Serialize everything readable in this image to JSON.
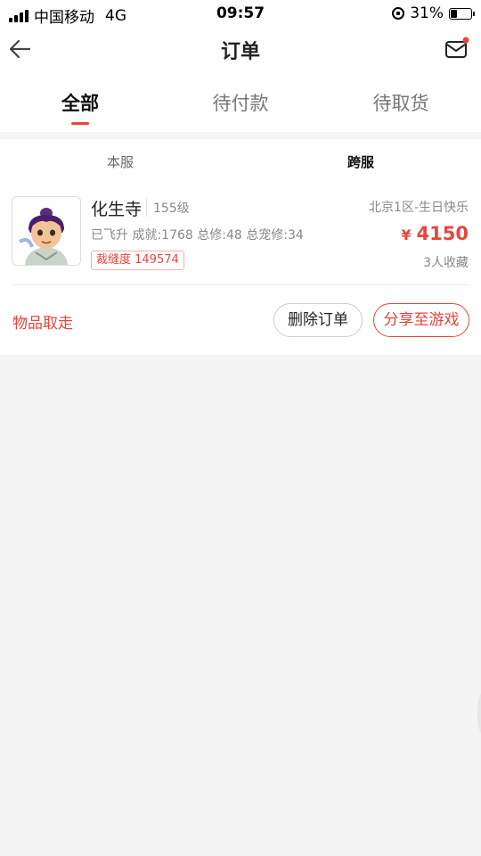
{
  "status_bar": {
    "carrier": "中国移动",
    "network": "4G",
    "time": "09:57",
    "battery_percent": "31%",
    "battery_level": 0.31
  },
  "nav": {
    "title": "订单",
    "back_icon": "arrow-left-icon",
    "mail_icon": "mail-icon",
    "mail_badge_color": "#e8453c"
  },
  "tabs": [
    {
      "label": "全部",
      "active": true
    },
    {
      "label": "待付款",
      "active": false
    },
    {
      "label": "待取货",
      "active": false
    }
  ],
  "subtabs": [
    {
      "label": "本服",
      "active": false
    },
    {
      "label": "跨服",
      "active": true
    }
  ],
  "order": {
    "name": "化生寺",
    "level": "155级",
    "stats": "已飞升 成就:1768 总修:48 总宠修:34",
    "badge": "裁缝度 149574",
    "server": "北京1区-生日快乐",
    "price_symbol": "¥",
    "price": "4150",
    "favorites": "3人收藏",
    "status": "物品取走",
    "delete_label": "删除订单",
    "share_label": "分享至游戏"
  },
  "colors": {
    "accent": "#e8453c",
    "background": "#f4f4f4"
  }
}
